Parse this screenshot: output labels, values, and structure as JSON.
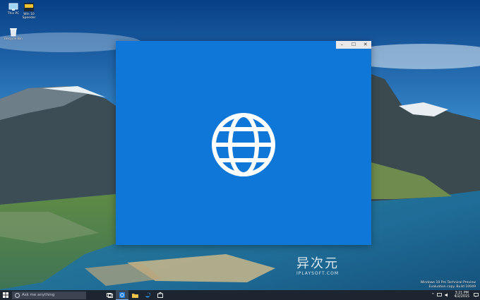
{
  "desktop": {
    "icons": [
      {
        "label": "This PC"
      },
      {
        "label": "Win 10 Speeder"
      },
      {
        "label": "Recycle Bin"
      }
    ]
  },
  "window": {
    "controls": {
      "minimize": "–",
      "maximize": "☐",
      "close": "✕"
    },
    "background_color": "#0f77d8",
    "icon": "globe-icon"
  },
  "watermark": {
    "logo_text": "异次元",
    "subtitle": "IPLAYSOFT.COM"
  },
  "eval_notice": {
    "line1": "Windows 10 Pro Technical Preview",
    "line2": "Evaluation copy. Build 10049"
  },
  "taskbar": {
    "search_placeholder": "Ask me anything",
    "clock": {
      "time": "3:21 PM",
      "date": "4/2/2015"
    }
  },
  "colors": {
    "accent": "#0f77d8",
    "taskbar": "#1d2530"
  }
}
